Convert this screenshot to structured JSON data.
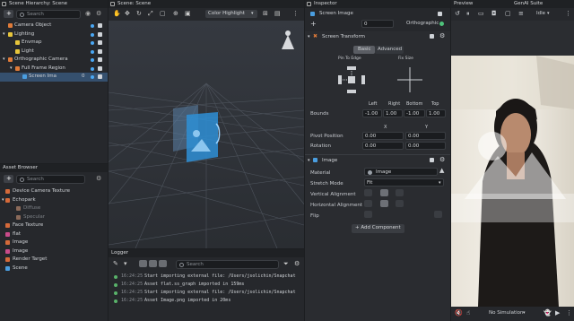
{
  "hierarchy": {
    "title": "Scene Hierarchy: Scene",
    "search_placeholder": "Search",
    "items": [
      {
        "label": "Camera Object",
        "depth": 0,
        "color": "#e07b39"
      },
      {
        "label": "Lighting",
        "depth": 0,
        "color": "#e7c53b"
      },
      {
        "label": "Envmap",
        "depth": 1,
        "color": "#e7c53b"
      },
      {
        "label": "Light",
        "depth": 1,
        "color": "#e7c53b"
      },
      {
        "label": "Orthographic Camera",
        "depth": 0,
        "color": "#e07b39"
      },
      {
        "label": "Full Frame Region",
        "depth": 1,
        "color": "#e07b39"
      },
      {
        "label": "Screen Ima",
        "depth": 2,
        "color": "#4a9ee0",
        "extra": "0"
      }
    ]
  },
  "assets": {
    "title": "Asset Browser",
    "search_placeholder": "Search",
    "items": [
      {
        "label": "Device Camera Texture",
        "depth": 0,
        "color": "#d56a3a",
        "dim": false
      },
      {
        "label": "Echopark",
        "depth": 0,
        "color": "#d56a3a",
        "dim": false
      },
      {
        "label": "Diffuse",
        "depth": 1,
        "color": "#8a6a5a",
        "dim": true
      },
      {
        "label": "Specular",
        "depth": 1,
        "color": "#8a6a5a",
        "dim": true
      },
      {
        "label": "Face Texture",
        "depth": 0,
        "color": "#d56a3a",
        "dim": false
      },
      {
        "label": "flat",
        "depth": 0,
        "color": "#c94b8a",
        "dim": false
      },
      {
        "label": "Image",
        "depth": 0,
        "color": "#d56a3a",
        "dim": false
      },
      {
        "label": "Image",
        "depth": 0,
        "color": "#c94b8a",
        "dim": false
      },
      {
        "label": "Render Target",
        "depth": 0,
        "color": "#d56a3a",
        "dim": false
      },
      {
        "label": "Scene",
        "depth": 0,
        "color": "#4a9ee0",
        "dim": false
      }
    ]
  },
  "scene": {
    "title": "Scene: Scene",
    "dropdown": "Color Highlight"
  },
  "logger": {
    "title": "Logger",
    "search_placeholder": "Search",
    "lines": [
      {
        "time": "16:24:25",
        "text": "Start importing external file: /Users/jsolichin/Snapchat"
      },
      {
        "time": "16:24:25",
        "text": "Asset flat.ss_graph imported in 159ms"
      },
      {
        "time": "16:24:25",
        "text": "Start importing external file: /Users/jsolichin/Snapchat"
      },
      {
        "time": "16:24:25",
        "text": "Asset Image.png imported in 20ms"
      }
    ]
  },
  "inspector": {
    "title": "Inspector",
    "object_name": "Screen Image",
    "layer_value": "0",
    "layer_label": "Orthographic",
    "screen_transform": {
      "title": "Screen Transform",
      "tab_basic": "Basic",
      "tab_advanced": "Advanced",
      "pin_label": "Pin To Edge",
      "fix_label": "Fix Size",
      "col_left": "Left",
      "col_right": "Right",
      "col_bottom": "Bottom",
      "col_top": "Top",
      "bounds_label": "Bounds",
      "bounds": [
        "-1.00",
        "1.00",
        "-1.00",
        "1.00"
      ],
      "col_x": "X",
      "col_y": "Y",
      "pivot_label": "Pivot Position",
      "pivot": [
        "0.00",
        "0.00"
      ],
      "rotation_label": "Rotation",
      "rotation": [
        "0.00",
        "0.00"
      ]
    },
    "image": {
      "title": "Image",
      "material_label": "Material",
      "material_value": "Image",
      "stretch_label": "Stretch Mode",
      "stretch_value": "Fit",
      "valign_label": "Vertical Alignment",
      "halign_label": "Horizontal Alignment",
      "flip_label": "Flip"
    },
    "add_component": "+ Add Component"
  },
  "preview": {
    "title": "Preview",
    "genai": "GenAI Suite",
    "status": "Idle",
    "simulation": "No Simulation"
  }
}
